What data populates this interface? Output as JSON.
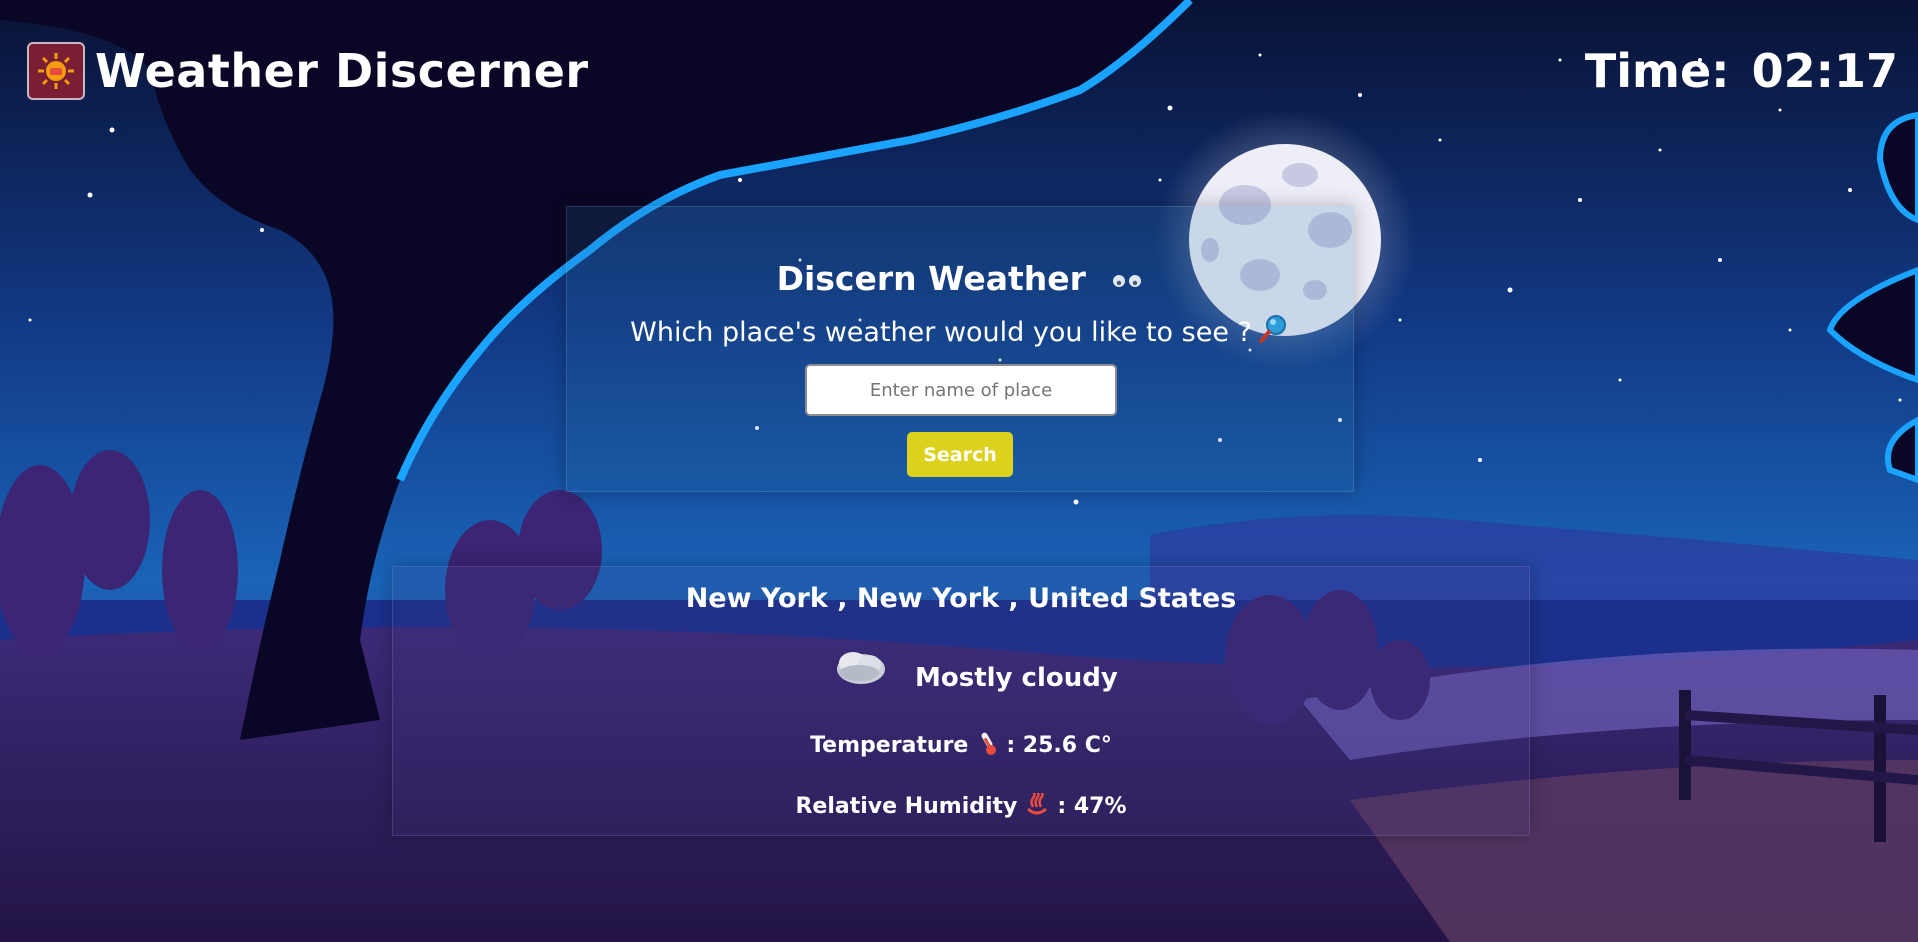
{
  "app": {
    "title": "Weather Discerner",
    "logo_icon": "sun-weather-logo-icon"
  },
  "clock": {
    "label": "Time:",
    "value": "02:17"
  },
  "search": {
    "heading": "Discern Weather",
    "heading_icon": "eyes-icon",
    "question": "Which place's weather would you like to see ?",
    "question_icon": "magnifier-icon",
    "placeholder": "Enter name of place",
    "value": "",
    "button_label": "Search"
  },
  "result": {
    "location": "New York , New York , United States",
    "condition_icon": "partly-cloudy-icon",
    "condition": "Mostly cloudy",
    "temperature_label": "Temperature",
    "temperature_icon": "thermometer-icon",
    "temperature_value": ": 25.6 C°",
    "humidity_label": "Relative Humidity",
    "humidity_icon": "hot-springs-icon",
    "humidity_value": ": 47%"
  },
  "colors": {
    "sky_top": "#0b1640",
    "sky_mid": "#14479a",
    "tree_outline": "#1aa3ff",
    "search_button": "#dcd21b",
    "logo_bg": "#7a1f33"
  }
}
